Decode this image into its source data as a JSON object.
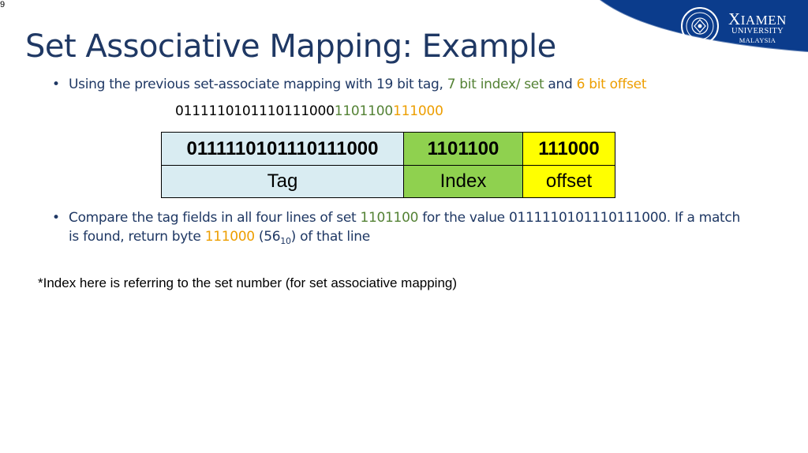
{
  "slide_number": "9",
  "logo": {
    "line1_initial": "X",
    "line1_rest": "IAMEN",
    "line2": "UNIVERSITY",
    "line3": "MALAYSIA",
    "brand_color": "#0B3C8C"
  },
  "title": "Set Associative Mapping: Example",
  "bullet1": {
    "pre": "Using the previous set-associate mapping with ",
    "tag_text": "19 bit tag",
    "sep1": ", ",
    "index_text": "7 bit index/ set",
    "sep2": " and ",
    "offset_text": "6 bit offset"
  },
  "bitstring": {
    "tag": "0111110101110111000",
    "index": "1101100",
    "offset": "111000"
  },
  "table": {
    "row1": [
      "0111110101110111000",
      "1101100",
      "111000"
    ],
    "row2": [
      "Tag",
      "Index",
      "offset"
    ]
  },
  "bullet2": {
    "p1": "Compare the tag fields in all four lines of set ",
    "set": "1101100",
    "p2": " for the value ",
    "tag": "0111110101110111000",
    "p3": ". If a match is found, return byte ",
    "byte": "111000",
    "p4": " (56",
    "sub": "10",
    "p5": ") of that line"
  },
  "note": "*Index here is referring to the set number (for set associative mapping)",
  "colors": {
    "title": "#1F3864",
    "tag_cell": "#D9ECF2",
    "index_cell": "#8FD14F",
    "offset_cell": "#FFFF00",
    "index_text": "#70AD47",
    "offset_text": "#F2B705"
  }
}
